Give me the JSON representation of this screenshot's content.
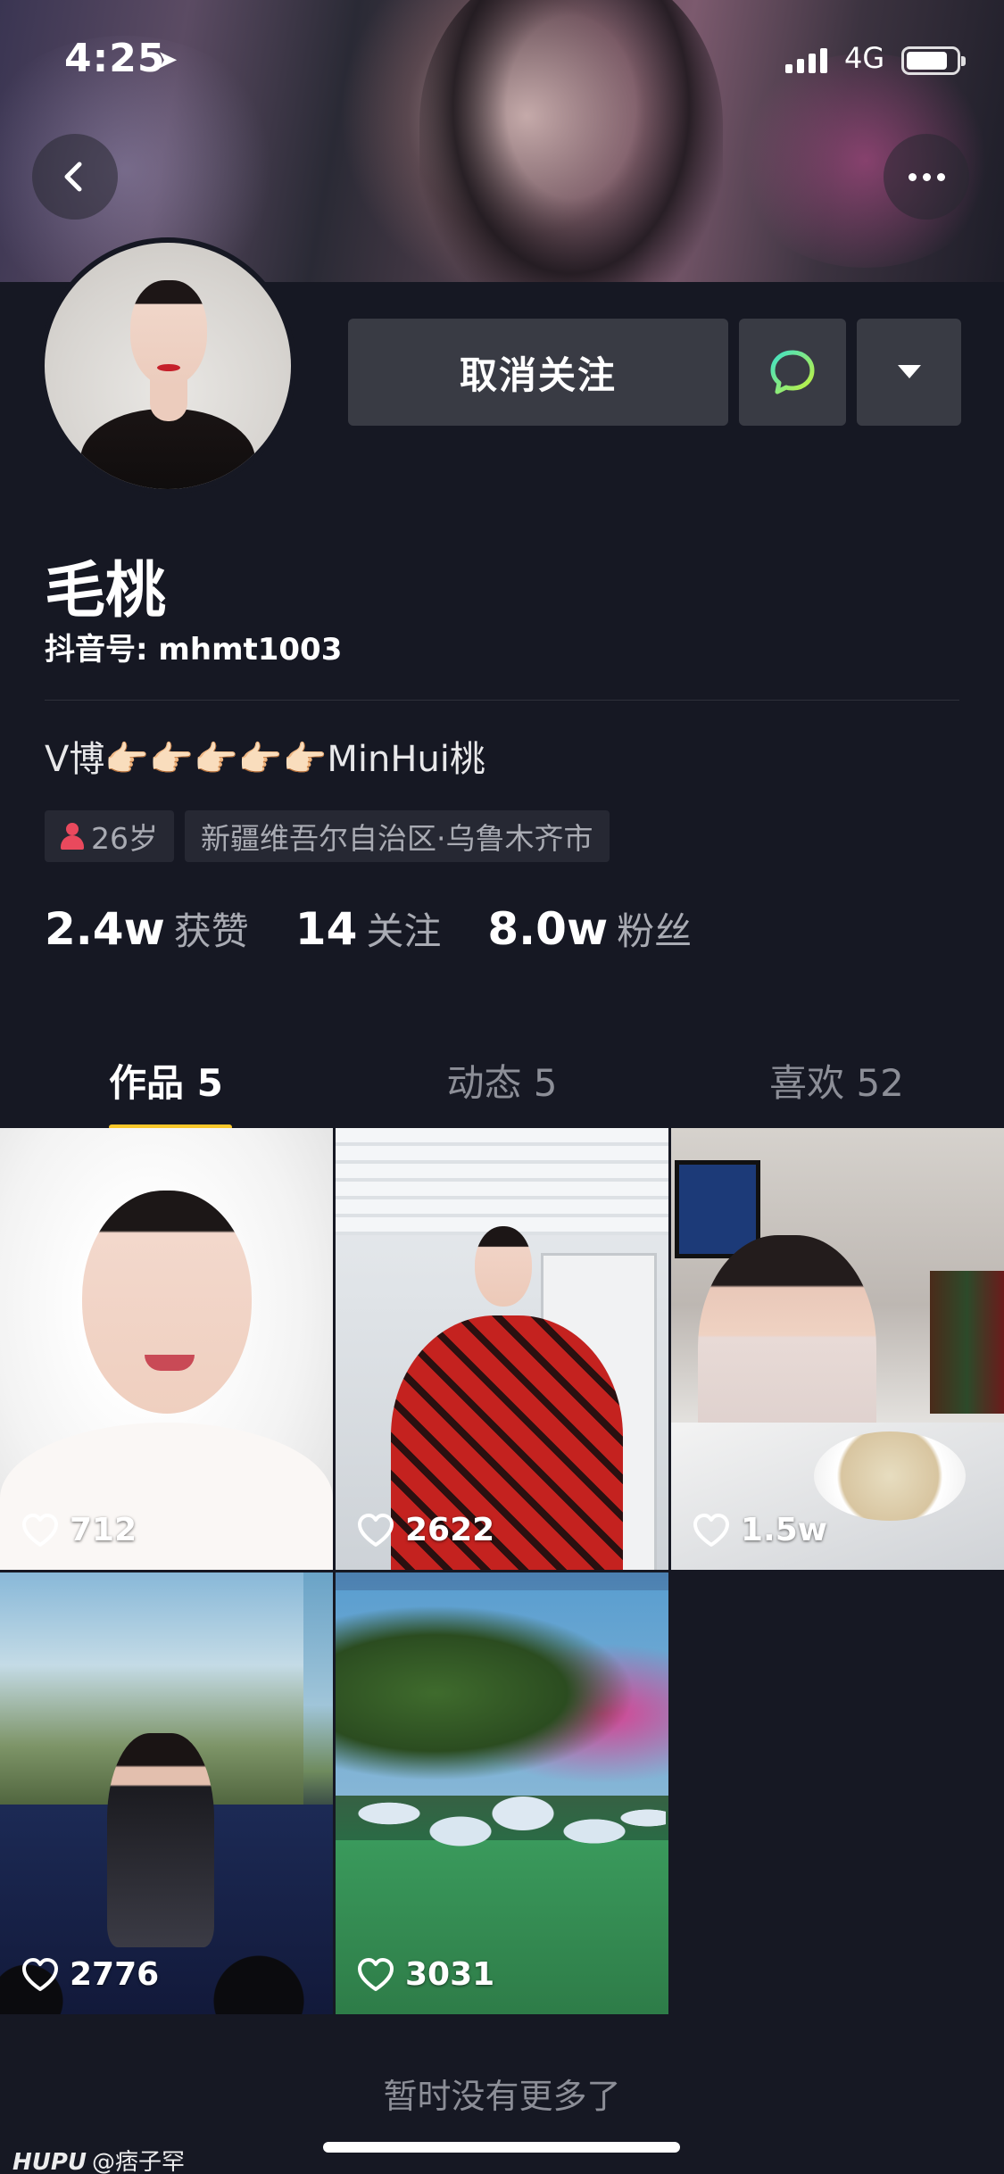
{
  "status_bar": {
    "time": "4:25",
    "network": "4G"
  },
  "header": {
    "back_icon": "chevron-left-icon",
    "more_icon": "more-horizontal-icon"
  },
  "profile": {
    "name": "毛桃",
    "douyin_id": "抖音号: mhmt1003",
    "bio": "V博👉🏻👉🏻👉🏻👉🏻👉🏻MinHui桃",
    "age_tag": "26岁",
    "location_tag": "新疆维吾尔自治区·乌鲁木齐市"
  },
  "actions": {
    "follow_label": "取消关注",
    "message_icon": "message-bubble-icon",
    "dropdown_icon": "triangle-down-icon",
    "accent_color": "#a4e840"
  },
  "stats": [
    {
      "num": "2.4w",
      "label": "获赞"
    },
    {
      "num": "14",
      "label": "关注"
    },
    {
      "num": "8.0w",
      "label": "粉丝"
    }
  ],
  "tabs": [
    {
      "label": "作品 5",
      "active": true
    },
    {
      "label": "动态 5",
      "active": false
    },
    {
      "label": "喜欢 52",
      "active": false
    }
  ],
  "tab_indicator_color": "#f9c72a",
  "videos": [
    {
      "likes": "712"
    },
    {
      "likes": "2622"
    },
    {
      "likes": "1.5w"
    },
    {
      "likes": "2776"
    },
    {
      "likes": "3031"
    }
  ],
  "footer": {
    "no_more": "暂时没有更多了"
  },
  "watermark": {
    "brand": "HUPU",
    "user": "@痞子罕"
  }
}
